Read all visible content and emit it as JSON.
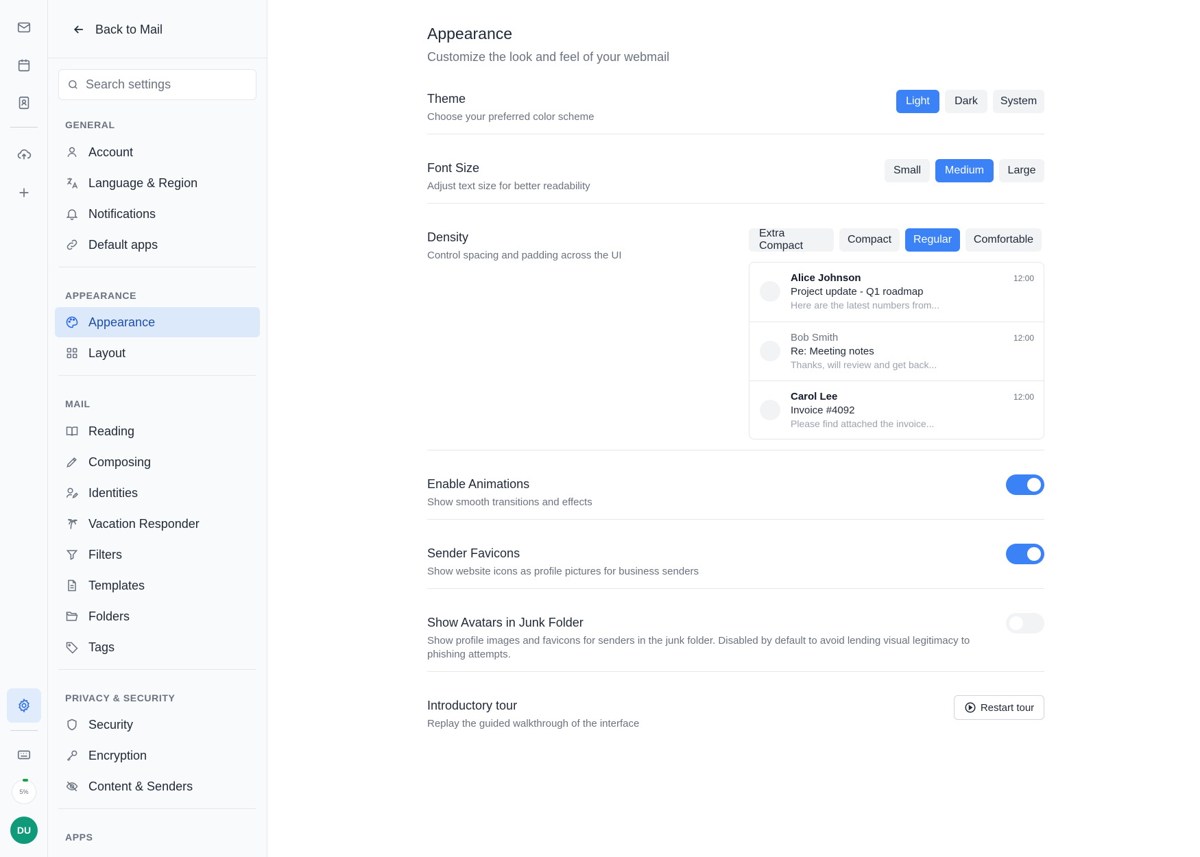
{
  "sidebar": {
    "back_label": "Back to Mail",
    "search_placeholder": "Search settings",
    "groups": [
      {
        "label": "GENERAL"
      },
      {
        "label": "APPEARANCE"
      },
      {
        "label": "MAIL"
      },
      {
        "label": "PRIVACY & SECURITY"
      },
      {
        "label": "APPS"
      }
    ],
    "items": [
      {
        "label": "Account",
        "icon": "user-icon"
      },
      {
        "label": "Language & Region",
        "icon": "translate-icon"
      },
      {
        "label": "Notifications",
        "icon": "bell-icon"
      },
      {
        "label": "Default apps",
        "icon": "link-icon"
      },
      {
        "label": "Appearance",
        "icon": "palette-icon",
        "active": true
      },
      {
        "label": "Layout",
        "icon": "grid-icon"
      },
      {
        "label": "Reading",
        "icon": "book-icon"
      },
      {
        "label": "Composing",
        "icon": "pen-icon"
      },
      {
        "label": "Identities",
        "icon": "user-pen-icon"
      },
      {
        "label": "Vacation Responder",
        "icon": "palm-tree-icon"
      },
      {
        "label": "Filters",
        "icon": "filter-icon"
      },
      {
        "label": "Templates",
        "icon": "document-icon"
      },
      {
        "label": "Folders",
        "icon": "folder-open-icon"
      },
      {
        "label": "Tags",
        "icon": "tag-icon"
      },
      {
        "label": "Security",
        "icon": "shield-icon"
      },
      {
        "label": "Encryption",
        "icon": "key-icon"
      },
      {
        "label": "Content & Senders",
        "icon": "eye-off-icon"
      }
    ]
  },
  "rail": {
    "storage_percent": "5%",
    "avatar_initials": "DU",
    "accent": "#2f6fdf",
    "avatar_color": "#0f9b7a"
  },
  "main": {
    "title": "Appearance",
    "subtitle": "Customize the look and feel of your webmail",
    "theme": {
      "title": "Theme",
      "desc": "Choose your preferred color scheme",
      "options": [
        "Light",
        "Dark",
        "System"
      ],
      "selected": "Light"
    },
    "font_size": {
      "title": "Font Size",
      "desc": "Adjust text size for better readability",
      "options": [
        "Small",
        "Medium",
        "Large"
      ],
      "selected": "Medium"
    },
    "density": {
      "title": "Density",
      "desc": "Control spacing and padding across the UI",
      "options": [
        "Extra Compact",
        "Compact",
        "Regular",
        "Comfortable"
      ],
      "selected": "Regular",
      "preview": [
        {
          "sender": "Alice Johnson",
          "subject": "Project update - Q1 roadmap",
          "snippet": "Here are the latest numbers from...",
          "time": "12:00",
          "unread": true
        },
        {
          "sender": "Bob Smith",
          "subject": "Re: Meeting notes",
          "snippet": "Thanks, will review and get back...",
          "time": "12:00",
          "unread": false
        },
        {
          "sender": "Carol Lee",
          "subject": "Invoice #4092",
          "snippet": "Please find attached the invoice...",
          "time": "12:00",
          "unread": true
        }
      ]
    },
    "animations": {
      "title": "Enable Animations",
      "desc": "Show smooth transitions and effects",
      "enabled": true
    },
    "favicons": {
      "title": "Sender Favicons",
      "desc": "Show website icons as profile pictures for business senders",
      "enabled": true
    },
    "junk_avatars": {
      "title": "Show Avatars in Junk Folder",
      "desc": "Show profile images and favicons for senders in the junk folder. Disabled by default to avoid lending visual legitimacy to phishing attempts.",
      "enabled": false
    },
    "tour": {
      "title": "Introductory tour",
      "desc": "Replay the guided walkthrough of the interface",
      "button_label": "Restart tour"
    },
    "accent_color": "#3b82f6"
  }
}
